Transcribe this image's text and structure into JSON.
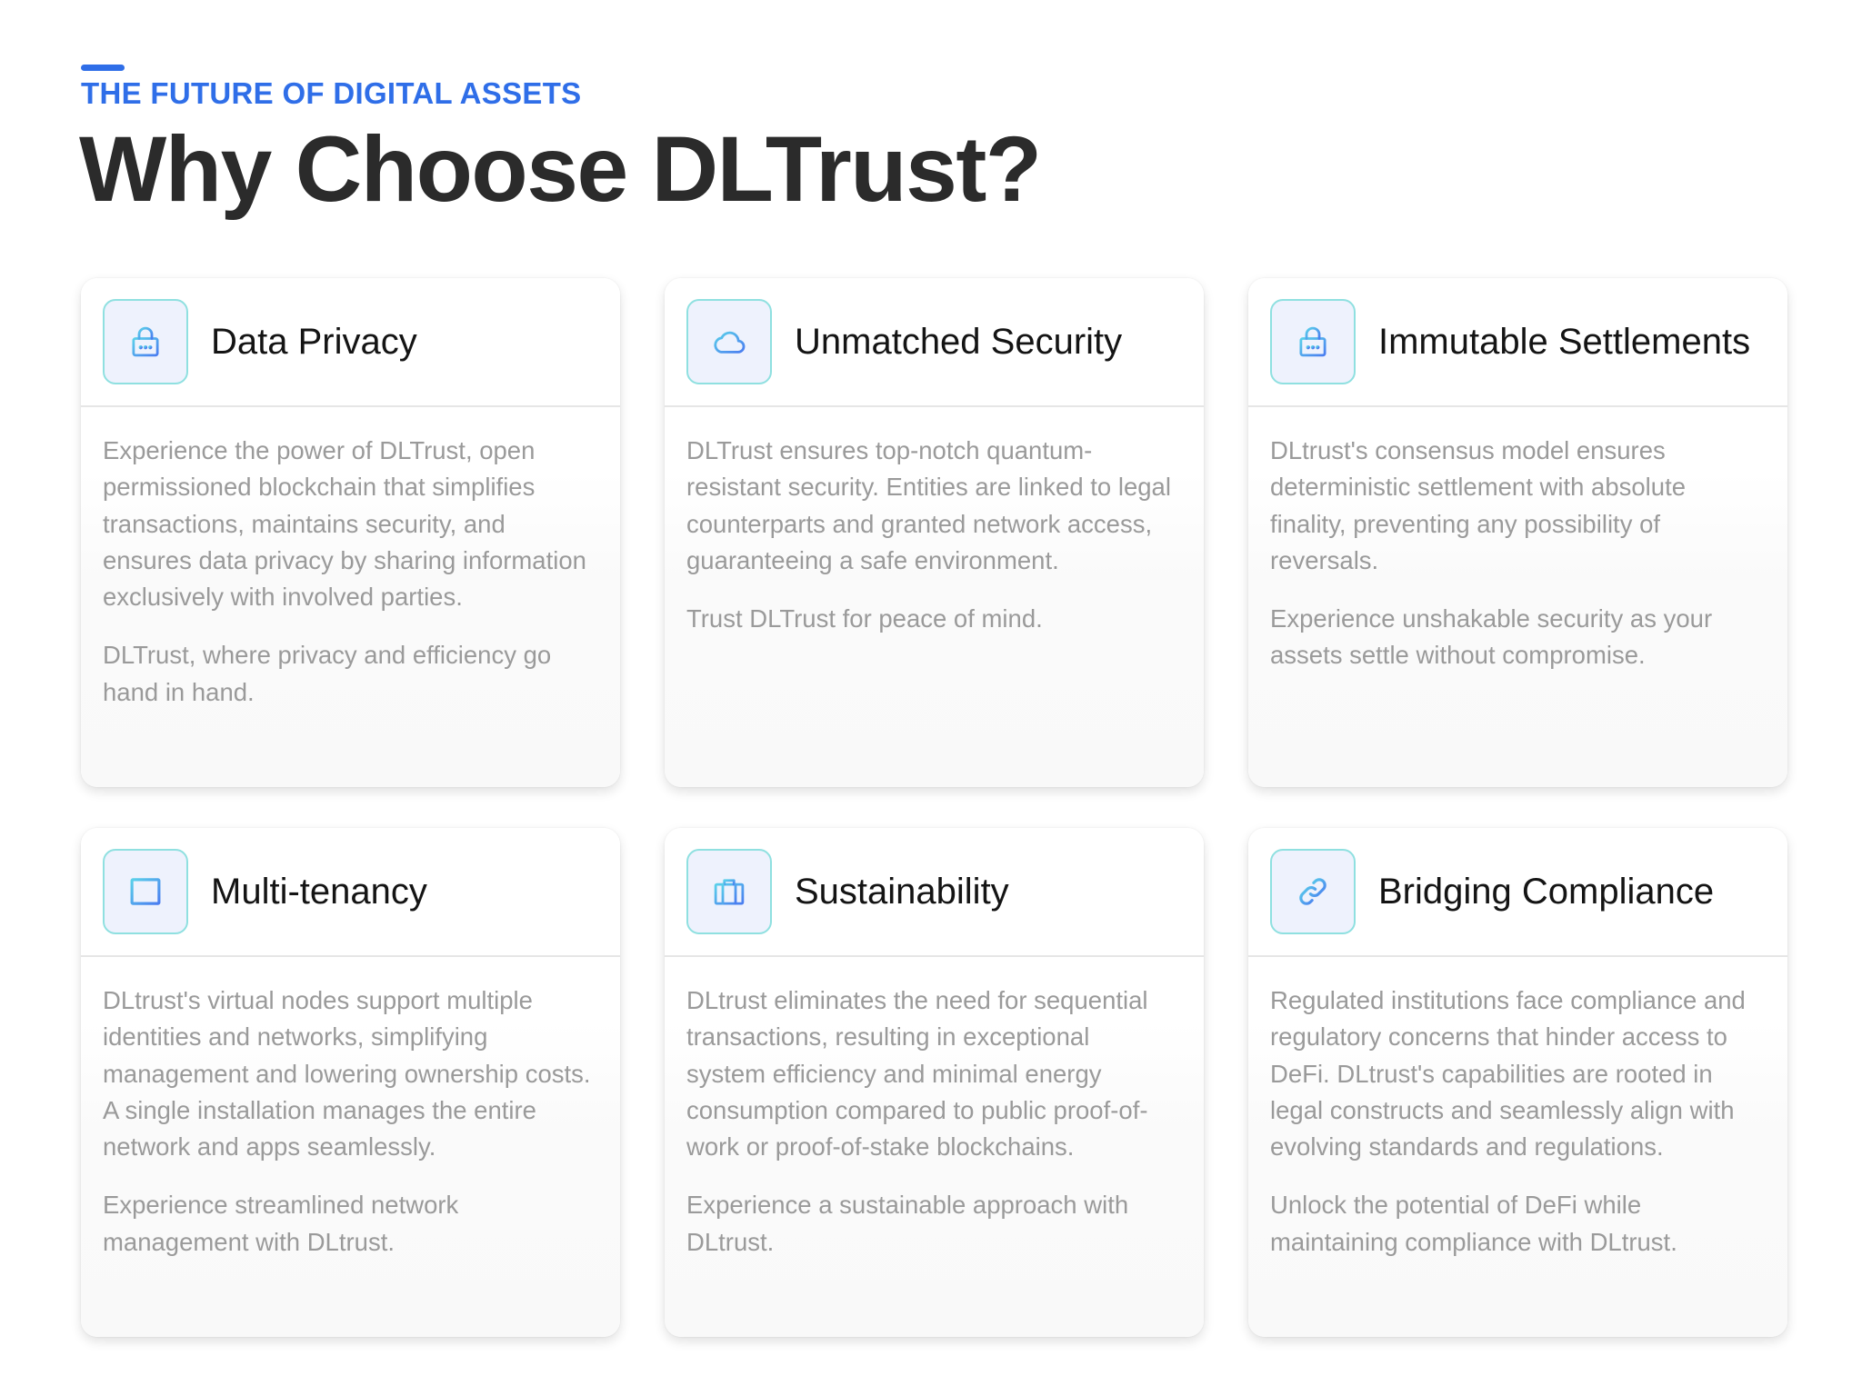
{
  "header": {
    "eyebrow": "THE FUTURE OF DIGITAL ASSETS",
    "title": "Why Choose DLTrust?"
  },
  "colors": {
    "accent": "#2f6ee8",
    "icon_border": "#8fe0e0",
    "icon_bg": "#eef2fd",
    "body_text": "#9a9a9a"
  },
  "cards": [
    {
      "icon": "lock-icon",
      "title": "Data Privacy",
      "paragraphs": [
        "Experience the power of DLTrust, open permissioned blockchain that simplifies transactions, maintains security, and ensures data privacy by sharing information exclusively with involved parties.",
        "DLTrust, where privacy and efficiency go hand in hand."
      ]
    },
    {
      "icon": "cloud-icon",
      "title": "Unmatched Security",
      "paragraphs": [
        "DLTrust ensures top-notch quantum-resistant security. Entities are linked to legal counterparts and granted network access, guaranteeing a safe environment.",
        "Trust DLTrust for peace of mind."
      ]
    },
    {
      "icon": "lock-icon",
      "title": "Immutable Settlements",
      "paragraphs": [
        "DLtrust's consensus model ensures deterministic settlement with absolute finality, preventing any possibility of reversals.",
        "Experience unshakable security as your assets settle without compromise."
      ]
    },
    {
      "icon": "panel-icon",
      "title": "Multi-tenancy",
      "paragraphs": [
        "DLtrust's virtual nodes support multiple identities and networks, simplifying management and lowering ownership costs. A single installation manages the entire network and apps seamlessly.",
        "Experience streamlined network management with DLtrust."
      ]
    },
    {
      "icon": "briefcase-icon",
      "title": "Sustainability",
      "paragraphs": [
        "DLtrust eliminates the need for sequential transactions, resulting in exceptional system efficiency and minimal energy consumption compared to public proof-of-work or proof-of-stake blockchains.",
        "Experience a sustainable approach with DLtrust."
      ]
    },
    {
      "icon": "link-icon",
      "title": "Bridging Compliance",
      "paragraphs": [
        "Regulated institutions face compliance and regulatory concerns that hinder access to DeFi. DLtrust's capabilities are rooted in legal constructs and seamlessly align with evolving standards and regulations.",
        "Unlock the potential of DeFi while maintaining compliance with DLtrust."
      ]
    }
  ]
}
